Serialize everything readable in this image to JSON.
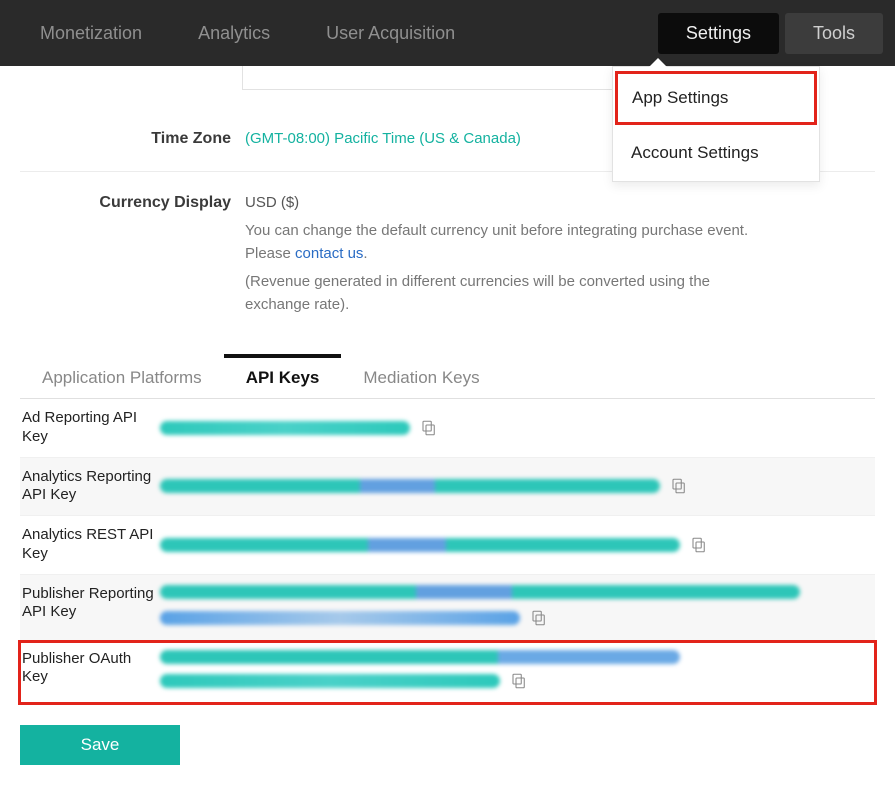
{
  "nav": {
    "monetization": "Monetization",
    "analytics": "Analytics",
    "user_acquisition": "User Acquisition",
    "settings": "Settings",
    "tools": "Tools"
  },
  "dropdown": {
    "app_settings": "App Settings",
    "account_settings": "Account Settings"
  },
  "form": {
    "timezone_label": "Time Zone",
    "timezone_value": "(GMT-08:00) Pacific Time (US & Canada)",
    "currency_label": "Currency Display",
    "currency_value": "USD ($)",
    "currency_desc1_a": "You can change the default currency unit before integrating purchase event. Please ",
    "currency_desc1_link": "contact us",
    "currency_desc1_b": ".",
    "currency_desc2": "(Revenue generated in different currencies will be converted using the exchange rate)."
  },
  "tabs": {
    "platforms": "Application Platforms",
    "api_keys": "API Keys",
    "mediation": "Mediation Keys"
  },
  "keys": {
    "ad_reporting": "Ad Reporting API Key",
    "analytics_reporting": "Analytics Reporting API Key",
    "analytics_rest": "Analytics REST API Key",
    "publisher_reporting": "Publisher Reporting API Key",
    "publisher_oauth": "Publisher OAuth Key"
  },
  "buttons": {
    "save": "Save"
  }
}
